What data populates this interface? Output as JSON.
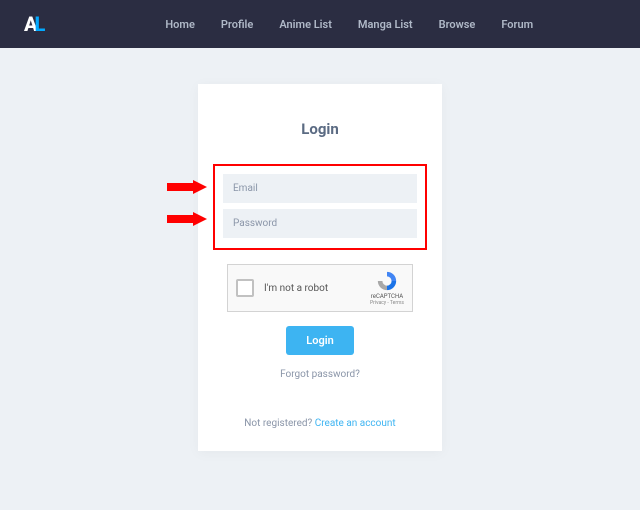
{
  "nav": {
    "links": [
      "Home",
      "Profile",
      "Anime List",
      "Manga List",
      "Browse",
      "Forum"
    ]
  },
  "login": {
    "title": "Login",
    "email_placeholder": "Email",
    "password_placeholder": "Password",
    "recaptcha_text": "I'm not a robot",
    "recaptcha_label": "reCAPTCHA",
    "recaptcha_sub": "Privacy - Terms",
    "button": "Login",
    "forgot": "Forgot password?",
    "not_registered": "Not registered? ",
    "create": "Create an account"
  }
}
